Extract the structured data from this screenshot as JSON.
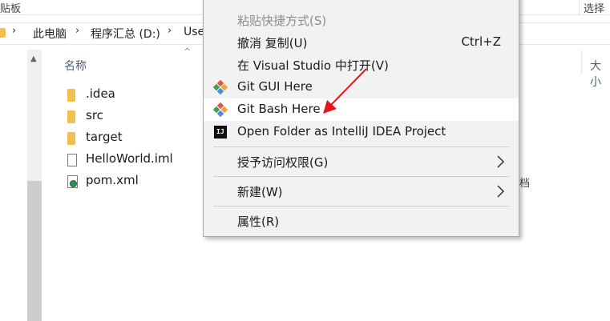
{
  "ribbon": {
    "left_label": "贴板",
    "right_label": "选择"
  },
  "address_bar": {
    "crumbs": [
      "此电脑",
      "程序汇总 (D:)",
      "Use"
    ]
  },
  "file_list": {
    "name_header": "名称",
    "size_header": "大小",
    "items": [
      {
        "name": ".idea",
        "type": "folder"
      },
      {
        "name": "src",
        "type": "folder"
      },
      {
        "name": "target",
        "type": "folder"
      },
      {
        "name": "HelloWorld.iml",
        "type": "file"
      },
      {
        "name": "pom.xml",
        "type": "xml"
      }
    ],
    "peek_text": "档"
  },
  "context_menu": {
    "items": [
      {
        "label": "粘贴快捷方式(S)",
        "disabled": true
      },
      {
        "label": "撤消 复制(U)",
        "shortcut": "Ctrl+Z"
      },
      {
        "label": "在 Visual Studio 中打开(V)"
      },
      {
        "label": "Git GUI Here",
        "icon": "git-gui-icon"
      },
      {
        "label": "Git Bash Here",
        "icon": "git-bash-icon",
        "highlighted": true
      },
      {
        "label": "Open Folder as IntelliJ IDEA Project",
        "icon": "intellij-idea-icon",
        "icon_text": "IJ"
      },
      {
        "label": "授予访问权限(G)",
        "submenu": true
      },
      {
        "label": "新建(W)",
        "submenu": true
      },
      {
        "label": "属性(R)"
      }
    ]
  },
  "colors": {
    "accent_arrow": "#e8141a",
    "folder": "#f3c04f",
    "menu_background": "#f2f2f2",
    "menu_hover": "#ffffff",
    "header_text": "#4c607a"
  }
}
